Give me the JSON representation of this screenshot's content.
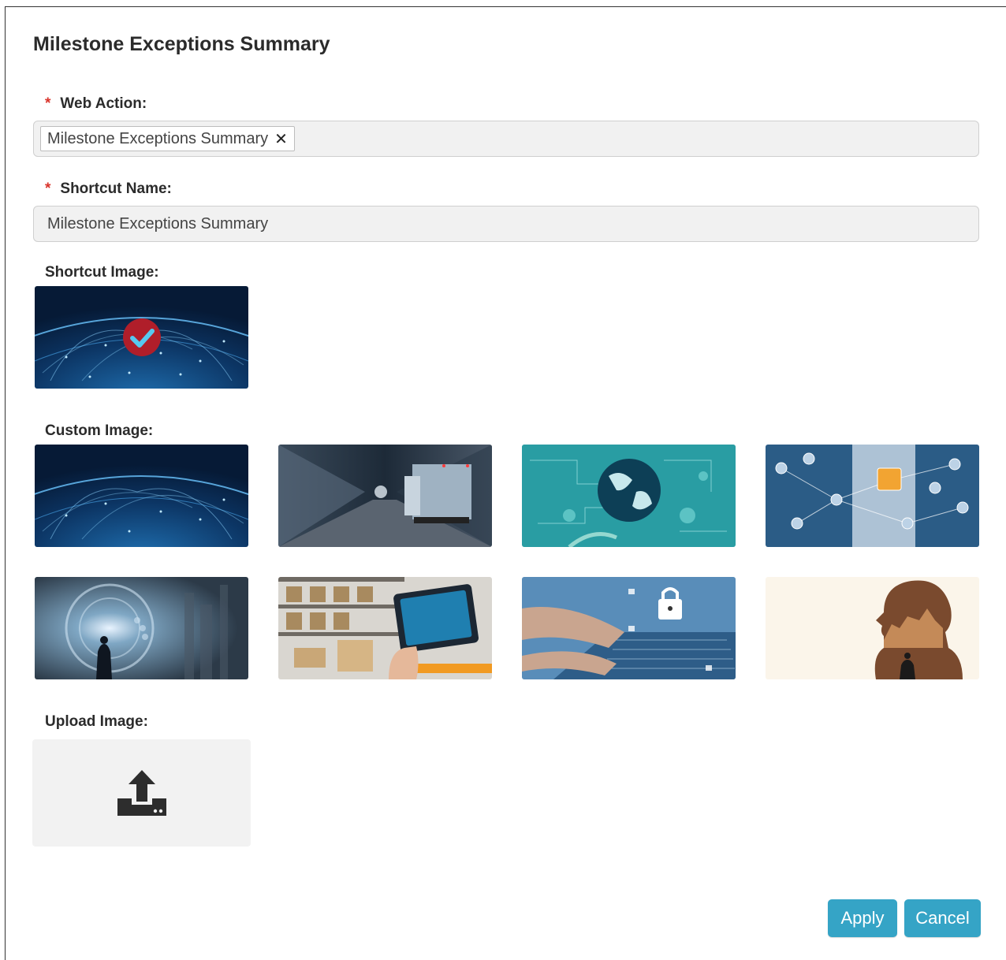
{
  "dialog": {
    "title": "Milestone Exceptions Summary"
  },
  "web_action": {
    "label": "Web Action:",
    "required_mark": "*",
    "selected_chip": "Milestone Exceptions Summary",
    "remove_glyph": "✕"
  },
  "shortcut_name": {
    "label": "Shortcut Name:",
    "required_mark": "*",
    "value": "Milestone Exceptions Summary"
  },
  "shortcut_image": {
    "label": "Shortcut Image:",
    "selected": "globe-network",
    "selected_badge_color": "#b01e2a"
  },
  "custom_image": {
    "label": "Custom Image:",
    "options": [
      "globe-network",
      "truck-tunnel",
      "earth-circuit",
      "network-icons-person",
      "man-vortex",
      "warehouse-tablet",
      "laptop-locks",
      "silhouette-city"
    ]
  },
  "upload_image": {
    "label": "Upload Image:",
    "icon": "upload-icon"
  },
  "buttons": {
    "apply": "Apply",
    "cancel": "Cancel"
  },
  "colors": {
    "accent": "#35a4c6",
    "required": "#d9342b"
  }
}
